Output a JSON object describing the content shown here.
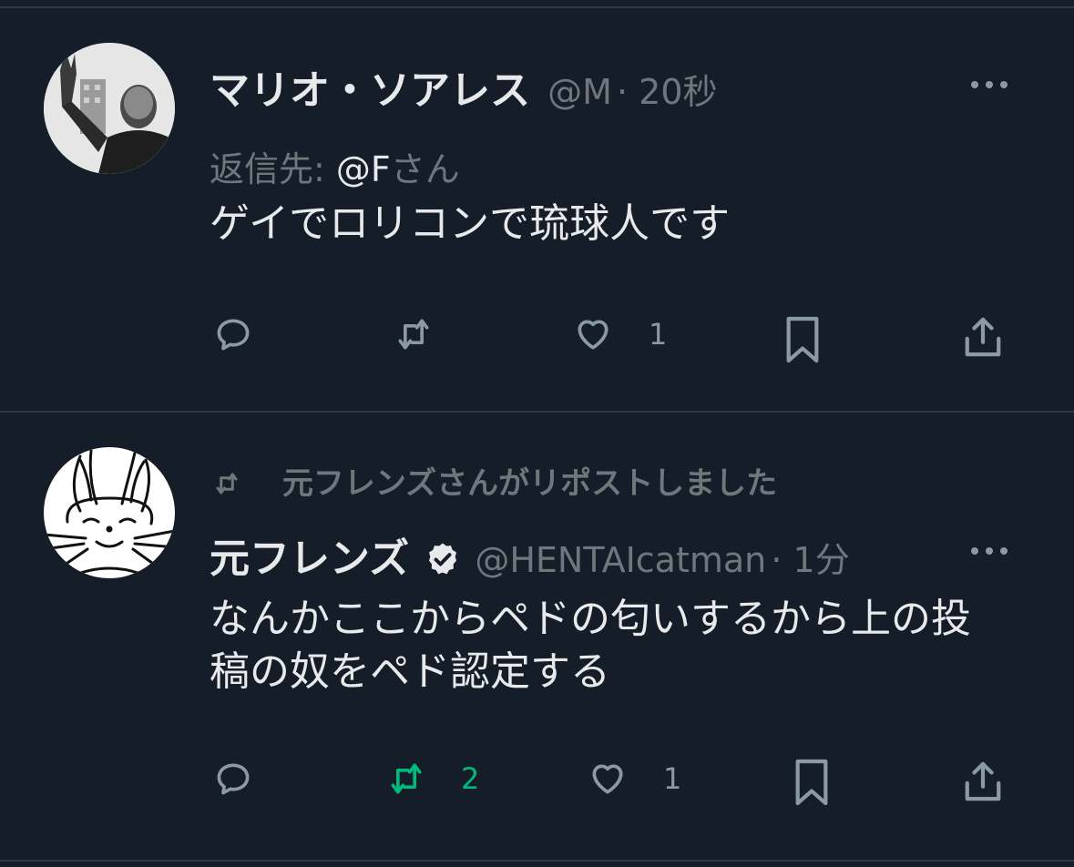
{
  "tweets": [
    {
      "name": "マリオ・ソアレス",
      "handle": "@M",
      "time": "· 20秒",
      "reply_prefix": "返信先: ",
      "reply_handle": "@F",
      "reply_suffix": "さん",
      "text": "ゲイでロリコンで琉球人です",
      "actions": {
        "reply": "",
        "repost": "",
        "like": "1",
        "bookmark": "",
        "share": ""
      }
    },
    {
      "reposted_by": "元フレンズさんがリポストしました",
      "name": "元フレンズ",
      "verified": true,
      "handle": "@HENTAIcatman",
      "time": "· 1分",
      "text": "なんかここからペドの匂いするから上の投稿の奴をペド認定する",
      "actions": {
        "reply": "",
        "repost": "2",
        "like": "1",
        "bookmark": "",
        "share": ""
      }
    }
  ],
  "colors": {
    "background": "#151d28",
    "text": "#e7e9ea",
    "muted": "#71767b",
    "icon": "#8b98a5",
    "repost_active": "#00ba7c",
    "divider": "#2f3843"
  },
  "icons": [
    "more-icon",
    "reply-icon",
    "repost-icon",
    "like-icon",
    "bookmark-icon",
    "share-icon",
    "verified-badge-icon"
  ]
}
